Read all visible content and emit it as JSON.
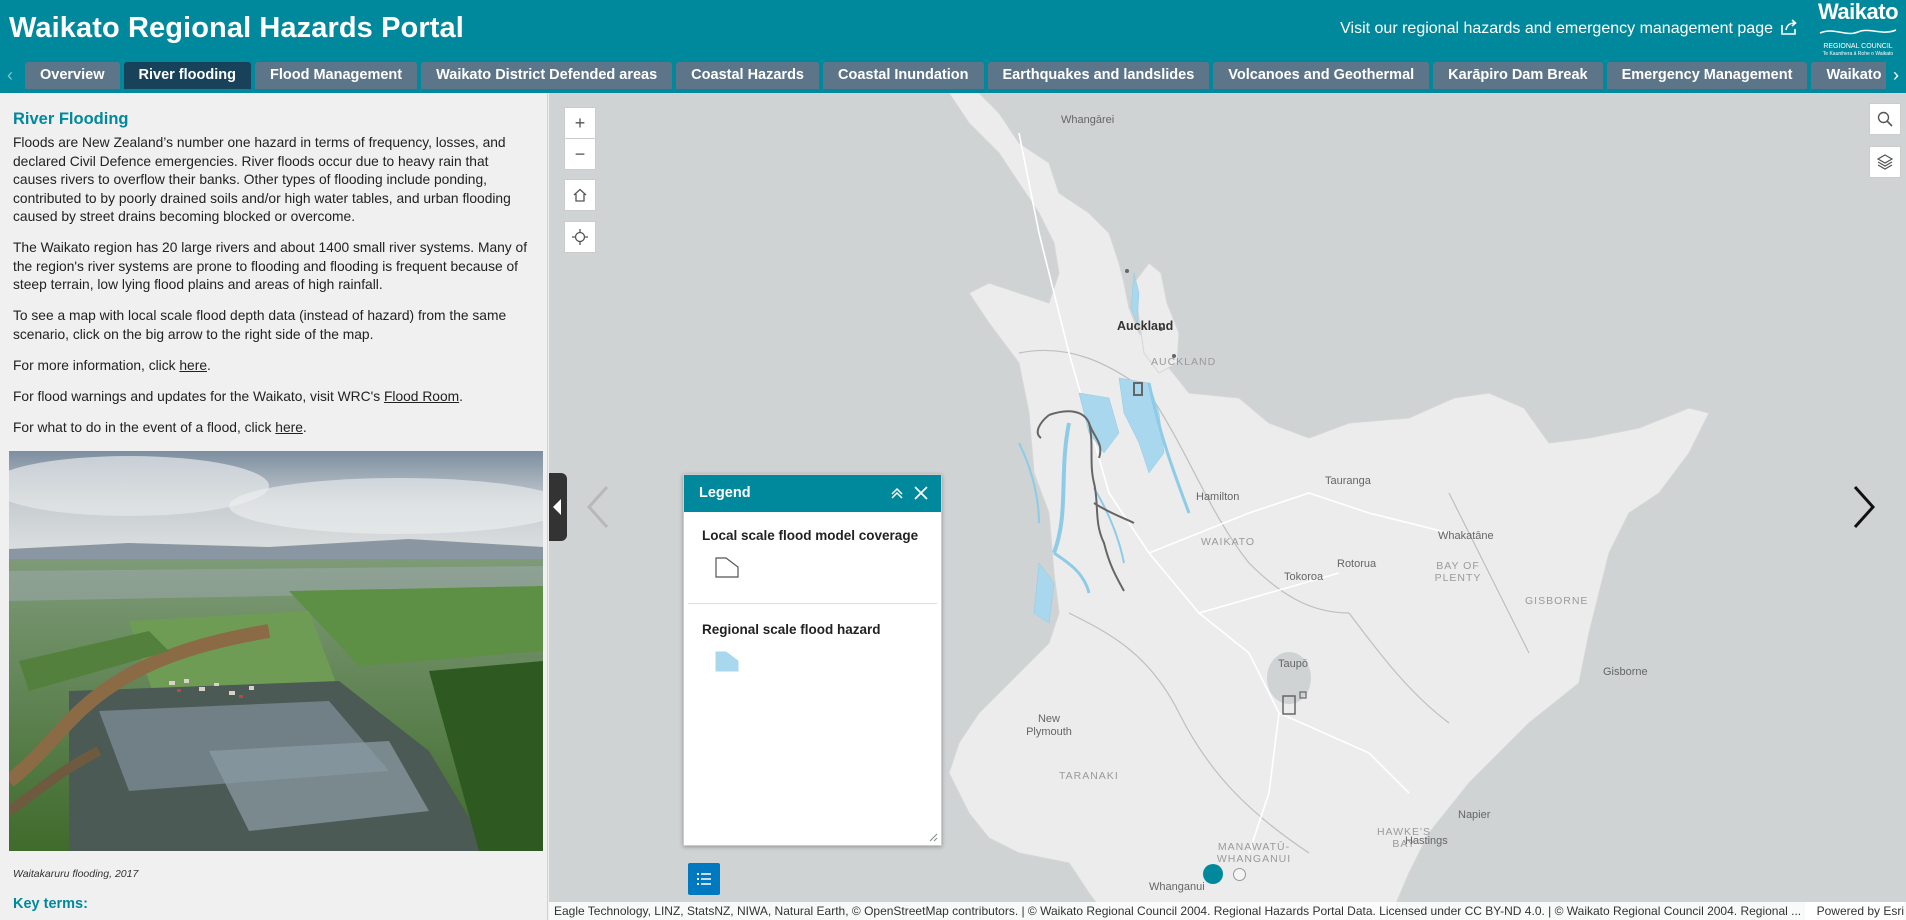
{
  "header": {
    "title": "Waikato Regional Hazards Portal",
    "visit_link": "Visit our regional hazards and emergency management page",
    "logo_big": "Waikato",
    "logo_small": "REGIONAL COUNCIL",
    "logo_tiny": "Te Kaunihera ā Rohe o Waikato"
  },
  "tabs": [
    {
      "label": "Overview"
    },
    {
      "label": "River flooding"
    },
    {
      "label": "Flood Management"
    },
    {
      "label": "Waikato District Defended areas"
    },
    {
      "label": "Coastal Hazards"
    },
    {
      "label": "Coastal Inundation"
    },
    {
      "label": "Earthquakes and landslides"
    },
    {
      "label": "Volcanoes and Geothermal"
    },
    {
      "label": "Karāpiro Dam Break"
    },
    {
      "label": "Emergency Management"
    },
    {
      "label": "Waikato Regional Cou"
    }
  ],
  "panel": {
    "heading": "River Flooding",
    "p1": "Floods are New Zealand’s number one hazard in terms of frequency, losses, and declared Civil Defence emergencies. River floods occur due to heavy rain that causes rivers to overflow their banks. Other types of flooding include ponding, contributed to by poorly drained soils and/or high water tables, and urban flooding caused by street drains becoming blocked or overcome.",
    "p2": "The Waikato region has 20 large rivers and about 1400 small river systems. Many of the region's river systems are prone to flooding and flooding is frequent because of steep terrain, low lying flood plains and areas of high rainfall.",
    "p3": "To see a map with local scale flood depth data (instead of hazard) from the same scenario, click on the big arrow to the right side of the map.",
    "p4_pre": "For more information, click ",
    "p4_link": "here",
    "p4_post": ".",
    "p5_pre": "For flood warnings and updates for the Waikato, visit WRC's ",
    "p5_link": "Flood Room",
    "p5_post": ".",
    "p6_pre": "For what to do in the event of a flood, click ",
    "p6_link": "here",
    "p6_post": ".",
    "caption": "Waitakaruru flooding, 2017",
    "key_terms": "Key terms:"
  },
  "map": {
    "zoom_in": "+",
    "zoom_out": "−",
    "labels": {
      "whangarei": "Whangārei",
      "auckland": "Auckland",
      "auckland_region": "AUCKLAND",
      "hamilton": "Hamilton",
      "waikato_region": "WAIKATO",
      "tauranga": "Tauranga",
      "whakatane": "Whakatāne",
      "rotorua": "Rotorua",
      "bay_of_plenty": "BAY OF PLENTY",
      "tokoroa": "Tokoroa",
      "gisborne_region": "GISBORNE",
      "taupo": "Taupō",
      "gisborne": "Gisborne",
      "new_plymouth": "New Plymouth",
      "taranaki": "TARANAKI",
      "napier": "Napier",
      "hawkes_bay": "HAWKE'S BAY",
      "hastings": "Hastings",
      "manawatu": "MANAWATŪ-WHANGANUI",
      "whanganui": "Whanganui"
    },
    "legend": {
      "title": "Legend",
      "item1": "Local scale flood model coverage",
      "item2": "Regional scale flood hazard"
    },
    "attribution": "Eagle Technology, LINZ, StatsNZ, NIWA, Natural Earth, © OpenStreetMap contributors. | © Waikato Regional Council 2004. Regional Hazards Portal Data. Licensed under CC BY-ND 4.0. | © Waikato Regional Council 2004. Regional ...",
    "powered_by": "Powered by Esri"
  },
  "colors": {
    "brand": "#00899c",
    "tab": "#5d7589",
    "tab_active": "#17425a",
    "flood": "#a9d8ee"
  }
}
